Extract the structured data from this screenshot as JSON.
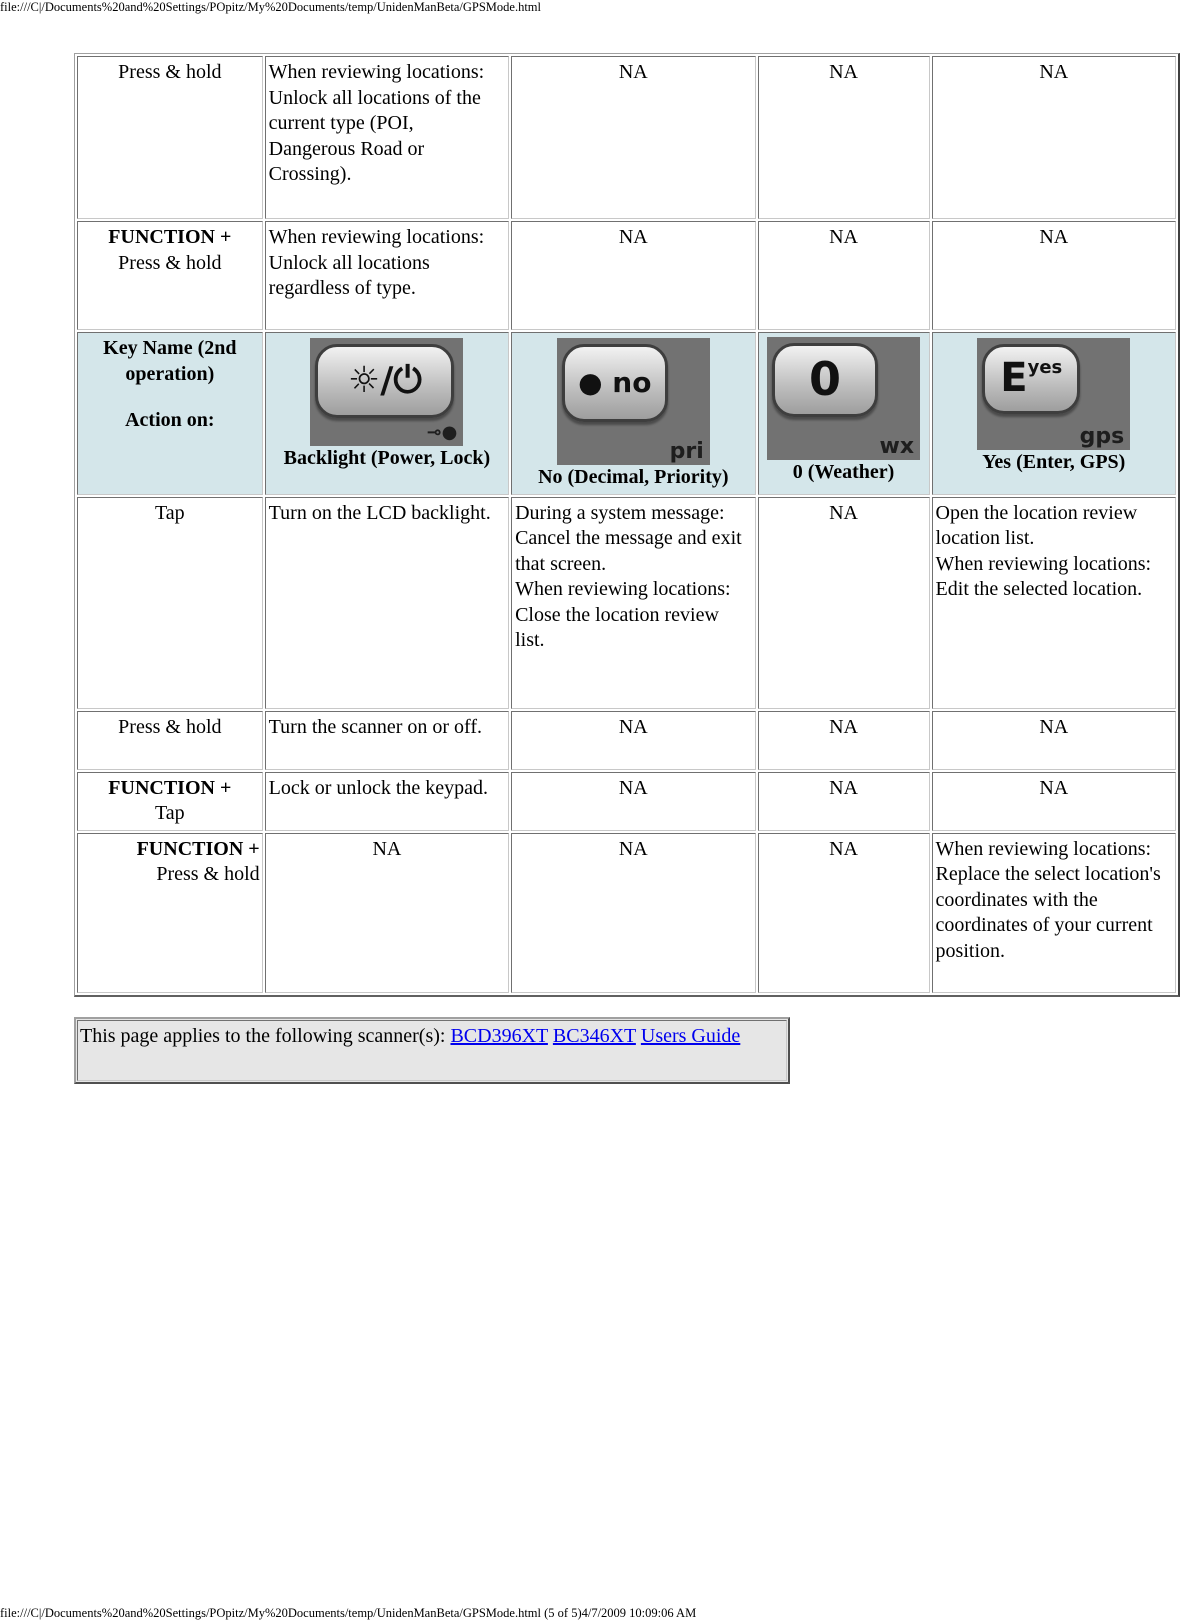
{
  "print_header": "file:///C|/Documents%20and%20Settings/POpitz/My%20Documents/temp/UnidenManBeta/GPSMode.html",
  "print_footer": "file:///C|/Documents%20and%20Settings/POpitz/My%20Documents/temp/UnidenManBeta/GPSMode.html (5 of 5)4/7/2009 10:09:06 AM",
  "top_rows": [
    {
      "action_bold": "",
      "action": "Press & hold",
      "cells": [
        "When reviewing locations:\nUnlock all locations of the current type (POI, Dangerous Road or Crossing).",
        "NA",
        "NA",
        "NA"
      ]
    },
    {
      "action_bold": "FUNCTION +",
      "action": "Press & hold",
      "cells": [
        "When reviewing locations:\nUnlock all locations regardless of type.",
        "NA",
        "NA",
        "NA"
      ]
    }
  ],
  "key_header": {
    "label_line1": "Key Name (2nd operation)",
    "label_line2": "Action on:",
    "background": "#d4e6ea",
    "keys": [
      {
        "icon": "backlight-power-key-icon",
        "main_glyph": "☼/⏻",
        "sub_glyph": "⊸●",
        "caption": "Backlight (Power, Lock)"
      },
      {
        "icon": "no-decimal-key-icon",
        "main_glyph": "● no",
        "sub_glyph": "pri",
        "caption": "No (Decimal, Priority)"
      },
      {
        "icon": "zero-weather-key-icon",
        "main_glyph": "0",
        "sub_glyph": "wx",
        "caption": "0 (Weather)"
      },
      {
        "icon": "yes-enter-key-icon",
        "main_glyph": "E",
        "main_sup": "yes",
        "sub_glyph": "gps",
        "caption": "Yes (Enter, GPS)"
      }
    ]
  },
  "bottom_rows": [
    {
      "action_bold": "",
      "action": "Tap",
      "cells": [
        "Turn on the LCD backlight.",
        "During a system message: Cancel the message and exit that screen.\nWhen reviewing locations:\nClose the location review list.",
        "NA",
        "Open the location review location list.\nWhen reviewing locations:\nEdit the selected location."
      ]
    },
    {
      "action_bold": "",
      "action": "Press & hold",
      "cells": [
        "Turn the scanner on or off.",
        "NA",
        "NA",
        "NA"
      ]
    },
    {
      "action_bold": "FUNCTION +",
      "action": "Tap",
      "cells": [
        "Lock or unlock the keypad.",
        "NA",
        "NA",
        "NA"
      ]
    },
    {
      "action_bold": "FUNCTION +",
      "action": "Press & hold",
      "cells": [
        "NA",
        "NA",
        "NA",
        "When reviewing locations:\nReplace the select location's coordinates with the coordinates of your current position."
      ]
    }
  ],
  "applies_box": {
    "text": "This page applies to the following scanner(s): ",
    "links": [
      {
        "label": "BCD396XT"
      },
      {
        "label": "BC346XT"
      },
      {
        "label": "Users Guide"
      }
    ],
    "background": "#e6e6e6",
    "link_color": "#0000ee"
  }
}
